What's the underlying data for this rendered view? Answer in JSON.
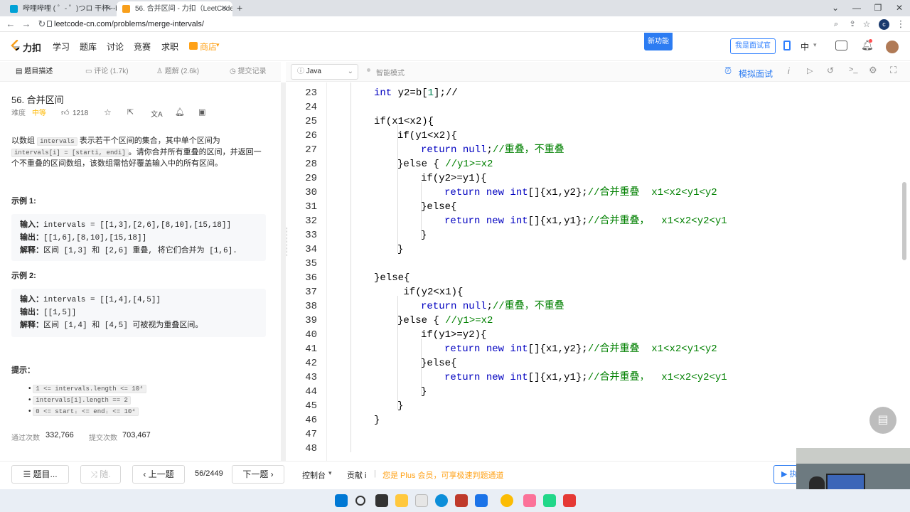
{
  "browser": {
    "tabs": [
      {
        "title": "哔哩哔哩 ( ゜- ゜)つロ 干杯~-bili"
      },
      {
        "title": "56. 合并区间 - 力扣（LeetCode"
      }
    ],
    "url": "leetcode-cn.com/problems/merge-intervals/",
    "new_tab_symbol": "+",
    "close_symbol": "✕"
  },
  "site": {
    "logo_text": "力扣",
    "nav": [
      "学习",
      "题库",
      "讨论",
      "竞赛",
      "求职",
      "商店"
    ],
    "new_feature_badge": "新功能",
    "interview_button": "我是面试官",
    "lang_switch": "中"
  },
  "left_tabs": {
    "description": "题目描述",
    "comments": "评论 (1.7k)",
    "solutions": "题解 (2.6k)",
    "submissions": "提交记录"
  },
  "editor_toolbar": {
    "language": "Java",
    "smart_mode": "智能模式",
    "mock_interview": "模拟面试"
  },
  "problem": {
    "title": "56. 合并区间",
    "difficulty_label": "难度",
    "difficulty": "中等",
    "likes": "1218",
    "desc_line1_a": "以数组",
    "desc_code1": "intervals",
    "desc_line1_b": "表示若干个区间的集合，其中单个区间为",
    "desc_code2": "intervals[i] = [starti, endi]",
    "desc_line2_b": "。请你合并所有重叠的区间，并返回一",
    "desc_line3": "个不重叠的区间数组，该数组需恰好覆盖输入中的所有区间。",
    "example1_title": "示例 1:",
    "example1": {
      "input_label": "输入：",
      "input": "intervals = [[1,3],[2,6],[8,10],[15,18]]",
      "output_label": "输出：",
      "output": "[[1,6],[8,10],[15,18]]",
      "explain_label": "解释：",
      "explain": "区间 [1,3] 和 [2,6] 重叠, 将它们合并为 [1,6]."
    },
    "example2_title": "示例 2:",
    "example2": {
      "input_label": "输入：",
      "input": "intervals = [[1,4],[4,5]]",
      "output_label": "输出：",
      "output": "[[1,5]]",
      "explain_label": "解释：",
      "explain": "区间 [1,4] 和 [4,5] 可被视为重叠区间。"
    },
    "hints_title": "提示：",
    "hints": [
      "1 <= intervals.length <= 10⁴",
      "intervals[i].length == 2",
      "0 <= startᵢ <= endᵢ <= 10⁴"
    ],
    "accepted_label": "通过次数",
    "accepted": "332,766",
    "submitted_label": "提交次数",
    "submitted": "703,467"
  },
  "editor": {
    "lines": [
      {
        "n": "23",
        "indent": 2,
        "code": "int y2=b[1];//"
      },
      {
        "n": "24",
        "indent": 0,
        "code": ""
      },
      {
        "n": "25",
        "indent": 2,
        "code": "if(x1<x2){"
      },
      {
        "n": "26",
        "indent": 3,
        "code": "if(y1<x2){"
      },
      {
        "n": "27",
        "indent": 4,
        "code": "return null;",
        "comment": "//重叠，不重叠"
      },
      {
        "n": "28",
        "indent": 3,
        "code": "}else { ",
        "comment": "//y1>=x2"
      },
      {
        "n": "29",
        "indent": 4,
        "code": "if(y2>=y1){"
      },
      {
        "n": "30",
        "indent": 5,
        "code": "return new int[]{x1,y2};",
        "comment": "//合并重叠  x1<x2<y1<y2"
      },
      {
        "n": "31",
        "indent": 4,
        "code": "}else{"
      },
      {
        "n": "32",
        "indent": 5,
        "code": "return new int[]{x1,y1};",
        "comment": "//合并重叠，  x1<x2<y2<y1"
      },
      {
        "n": "33",
        "indent": 4,
        "code": "}"
      },
      {
        "n": "34",
        "indent": 3,
        "code": "}"
      },
      {
        "n": "35",
        "indent": 0,
        "code": ""
      },
      {
        "n": "36",
        "indent": 2,
        "code": "}else{"
      },
      {
        "n": "37",
        "indent": 3,
        "code": " if(y2<x1){"
      },
      {
        "n": "38",
        "indent": 4,
        "code": "return null;",
        "comment": "//重叠，不重叠"
      },
      {
        "n": "39",
        "indent": 3,
        "code": "}else { ",
        "comment": "//y1>=x2"
      },
      {
        "n": "40",
        "indent": 4,
        "code": "if(y1>=y2){"
      },
      {
        "n": "41",
        "indent": 5,
        "code": "return new int[]{x1,y2};",
        "comment": "//合并重叠  x1<x2<y1<y2"
      },
      {
        "n": "42",
        "indent": 4,
        "code": "}else{"
      },
      {
        "n": "43",
        "indent": 5,
        "code": "return new int[]{x1,y1};",
        "comment": "//合并重叠，  x1<x2<y2<y1"
      },
      {
        "n": "44",
        "indent": 4,
        "code": "}"
      },
      {
        "n": "45",
        "indent": 3,
        "code": "}"
      },
      {
        "n": "46",
        "indent": 2,
        "code": "}"
      },
      {
        "n": "47",
        "indent": 0,
        "code": ""
      },
      {
        "n": "48",
        "indent": 0,
        "code": ""
      }
    ]
  },
  "footer": {
    "list_button": "题目...",
    "random_button": "随.",
    "prev_button": "上一题",
    "page": "56/2449",
    "next_button": "下一题",
    "console": "控制台",
    "contribute": "贡献 i",
    "plus_promo": "您是 Plus 会员，可享极速判题通道",
    "run_button": "执"
  },
  "colors": {
    "accent": "#2c7cf2",
    "medium": "#ffb800",
    "keyword": "#0000c0",
    "comment": "#008000"
  }
}
